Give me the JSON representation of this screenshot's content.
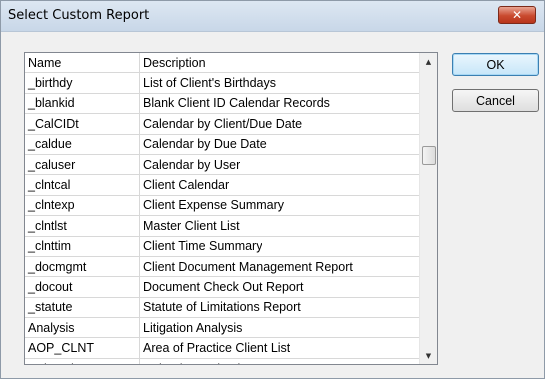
{
  "window": {
    "title": "Select Custom Report",
    "close_glyph": "✕"
  },
  "list": {
    "columns": [
      "Name",
      "Description"
    ],
    "rows": [
      {
        "name": "_birthdy",
        "description": "List of Client's Birthdays"
      },
      {
        "name": "_blankid",
        "description": "Blank Client ID Calendar Records"
      },
      {
        "name": "_CalCIDt",
        "description": "Calendar by Client/Due Date"
      },
      {
        "name": "_caldue",
        "description": "Calendar by Due Date"
      },
      {
        "name": "_caluser",
        "description": "Calendar by User"
      },
      {
        "name": "_clntcal",
        "description": "Client Calendar"
      },
      {
        "name": "_clntexp",
        "description": "Client Expense Summary"
      },
      {
        "name": "_clntlst",
        "description": "Master Client List"
      },
      {
        "name": "_clnttim",
        "description": "Client Time Summary"
      },
      {
        "name": "_docmgmt",
        "description": "Client Document Management Report"
      },
      {
        "name": "_docout",
        "description": "Document Check Out Report"
      },
      {
        "name": "_statute",
        "description": "Statute of Limitations Report"
      },
      {
        "name": "Analysis",
        "description": "Litigation Analysis"
      },
      {
        "name": "AOP_CLNT",
        "description": "Area of Practice Client List"
      },
      {
        "name": "Cal_code",
        "description": "Calendar Code List"
      }
    ]
  },
  "scrollbar": {
    "up_glyph": "▲",
    "down_glyph": "▼"
  },
  "buttons": {
    "ok_label": "OK",
    "cancel_label": "Cancel"
  }
}
